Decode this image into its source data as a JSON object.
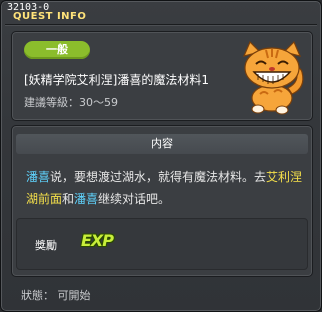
{
  "window": {
    "id_label": "32103-0",
    "title": "QUEST INFO"
  },
  "quest": {
    "badge": "一般",
    "name": "[妖精学院艾利涅]潘喜的魔法材料1",
    "level_req": "建議等級：30～59",
    "mascot": "cat-icon"
  },
  "content": {
    "title": "内容",
    "segments": [
      {
        "text": "潘喜",
        "style": "hl"
      },
      {
        "text": "说，要想渡过湖水，就得有魔法材料。去",
        "style": ""
      },
      {
        "text": "艾利涅湖前面",
        "style": "yl"
      },
      {
        "text": "和",
        "style": ""
      },
      {
        "text": "潘喜",
        "style": "hl"
      },
      {
        "text": "继续对话吧。",
        "style": ""
      }
    ]
  },
  "reward": {
    "label": "獎勵",
    "icon": "exp-icon",
    "icon_text": "EXP"
  },
  "status": {
    "text": "狀態： 可開始"
  },
  "colors": {
    "badge": "#8bbd2c",
    "highlight_blue": "#5fd4ff",
    "highlight_yellow": "#f5e04a",
    "exp": "#c8ee3a",
    "title_yellow": "#ffe37a"
  }
}
